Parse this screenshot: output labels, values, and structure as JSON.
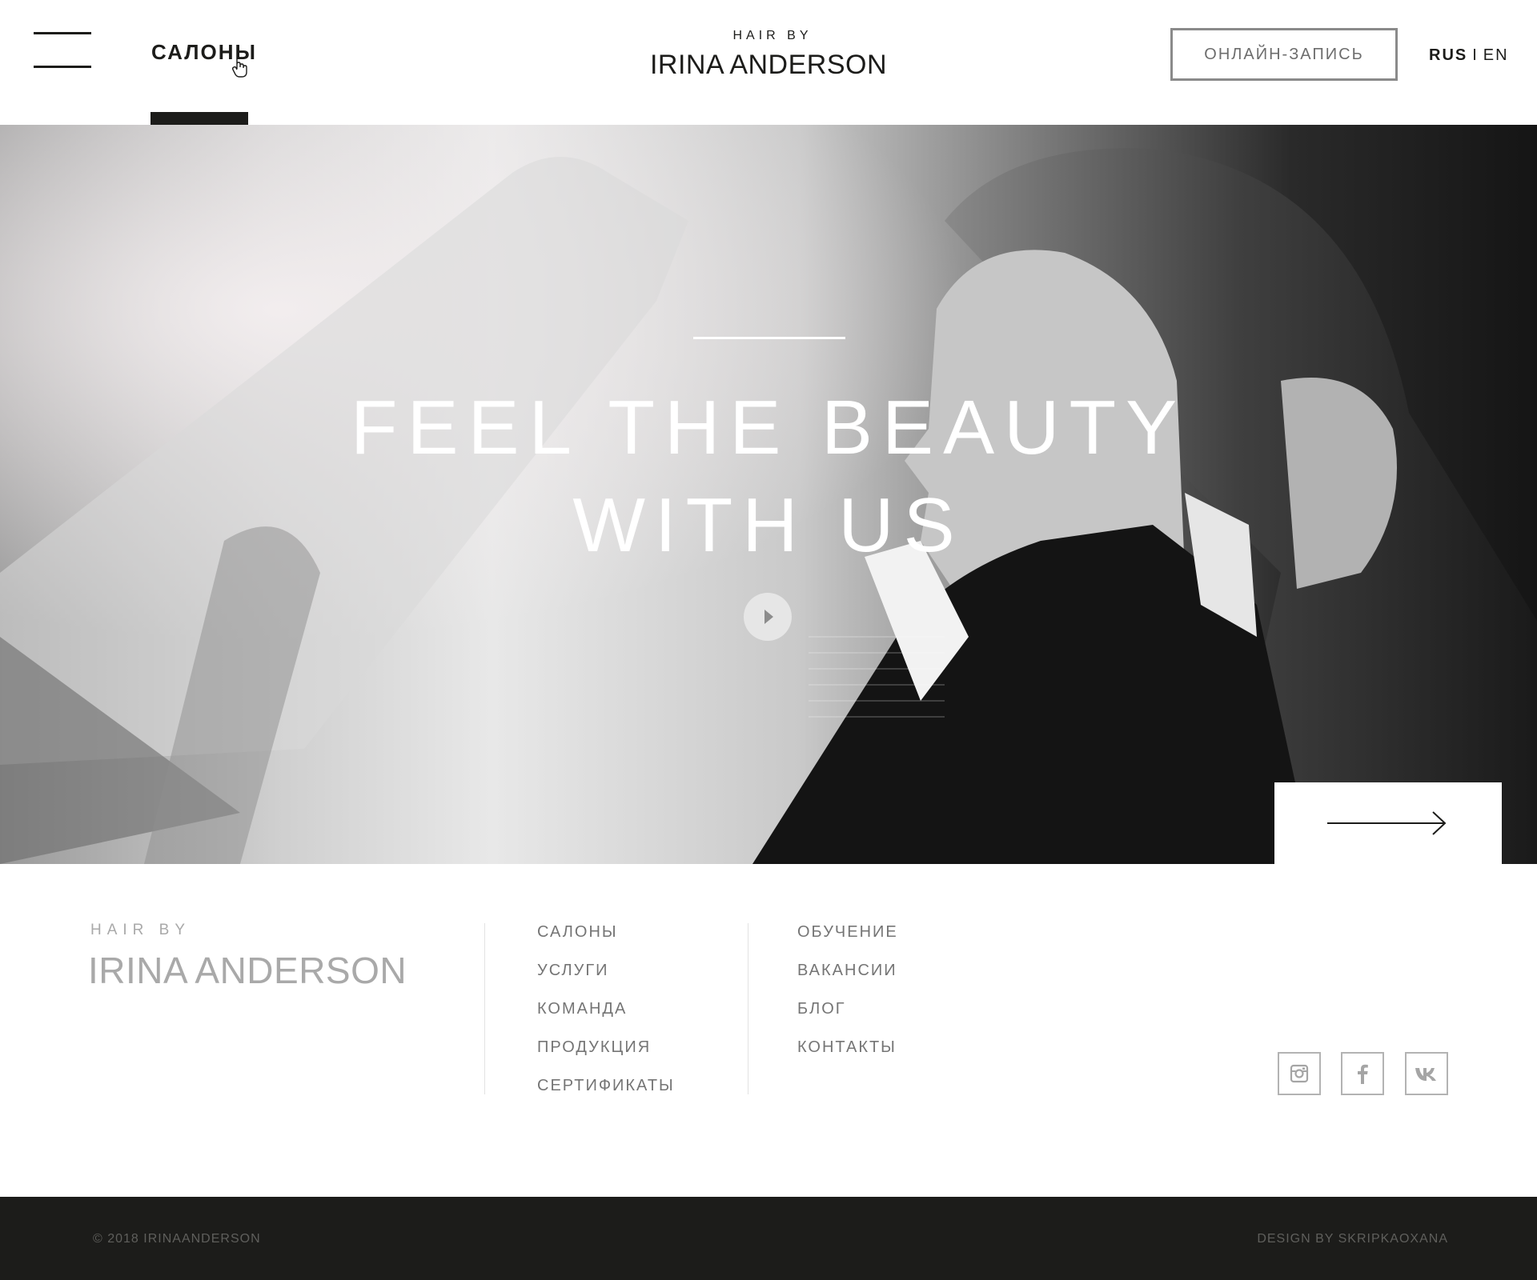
{
  "header": {
    "nav_label": "САЛОНЫ",
    "brand_small": "HAIR BY",
    "brand_big": "IRINA ANDERSON",
    "book_button": "ОНЛАЙН-ЗАПИСЬ",
    "lang_active": "RUS",
    "lang_separator": "I",
    "lang_other": "EN"
  },
  "hero": {
    "title_line1": "FEEL THE BEAUTY",
    "title_line2": "WITH US",
    "play_icon": "play-icon",
    "next_icon": "arrow-right-icon"
  },
  "footer": {
    "brand_small": "HAIR BY",
    "brand_big": "IRINA ANDERSON",
    "col1": [
      "САЛОНЫ",
      "УСЛУГИ",
      "КОМАНДА",
      "ПРОДУКЦИЯ",
      "СЕРТИФИКАТЫ"
    ],
    "col2": [
      "ОБУЧЕНИЕ",
      "ВАКАНСИИ",
      "БЛОГ",
      "КОНТАКТЫ"
    ],
    "social": [
      "instagram-icon",
      "facebook-icon",
      "vk-icon"
    ],
    "copyright": "© 2018 IRINAANDERSON",
    "design_credit": "DESIGN BY SKRIPKAOXANA"
  },
  "colors": {
    "dark": "#1c1c1a",
    "footer_text": "#757575",
    "muted_brand": "#a9a9a9"
  }
}
